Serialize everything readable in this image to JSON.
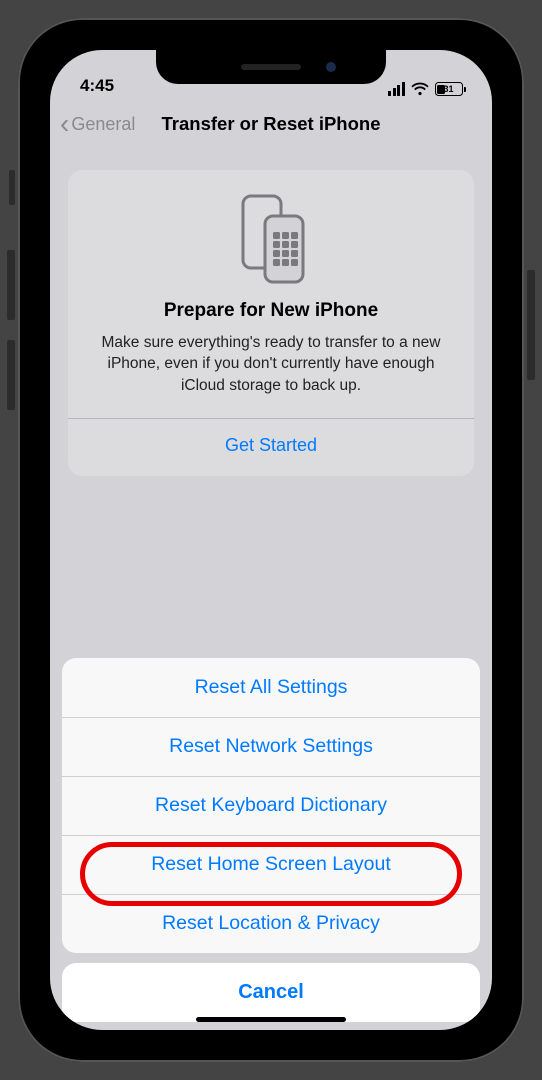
{
  "status": {
    "time": "4:45",
    "battery_pct": "31"
  },
  "nav": {
    "back_label": "General",
    "title": "Transfer or Reset iPhone"
  },
  "prepare_card": {
    "title": "Prepare for New iPhone",
    "description": "Make sure everything's ready to transfer to a new iPhone, even if you don't currently have enough iCloud storage to back up.",
    "action_label": "Get Started"
  },
  "action_sheet": {
    "items": [
      "Reset All Settings",
      "Reset Network Settings",
      "Reset Keyboard Dictionary",
      "Reset Home Screen Layout",
      "Reset Location & Privacy"
    ],
    "cancel_label": "Cancel"
  },
  "annotation": {
    "highlighted_item_index": 3
  }
}
